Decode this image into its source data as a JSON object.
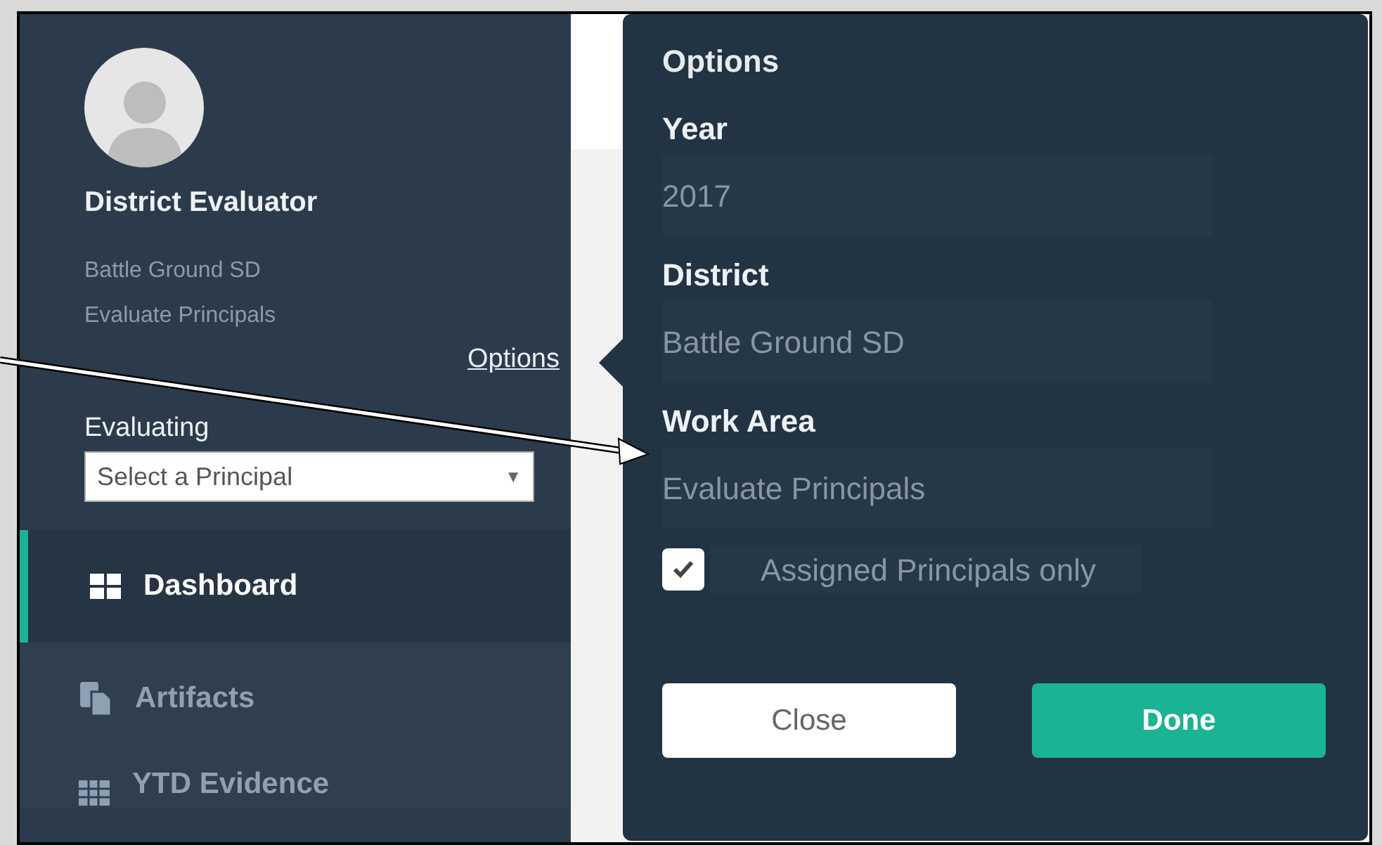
{
  "sidebar": {
    "user": {
      "name": "District Evaluator",
      "lines": [
        "Battle Ground SD",
        "Evaluate Principals"
      ]
    },
    "options_link": "Options",
    "evaluating": {
      "label": "Evaluating",
      "placeholder": "Select a Principal",
      "caret": "▼"
    },
    "nav": [
      {
        "label": "Dashboard",
        "selected": true
      },
      {
        "label": "Artifacts",
        "selected": false
      },
      {
        "label": "YTD Evidence",
        "selected": false
      }
    ]
  },
  "options_popover": {
    "title": "Options",
    "fields": [
      {
        "label": "Year",
        "value": "2017"
      },
      {
        "label": "District",
        "value": "Battle Ground SD"
      },
      {
        "label": "Work Area",
        "value": "Evaluate Principals"
      }
    ],
    "assigned_only": {
      "label": "Assigned Principals only",
      "checked": true
    },
    "buttons": [
      {
        "label": "Close",
        "kind": "secondary"
      },
      {
        "label": "Done",
        "kind": "primary"
      }
    ]
  }
}
